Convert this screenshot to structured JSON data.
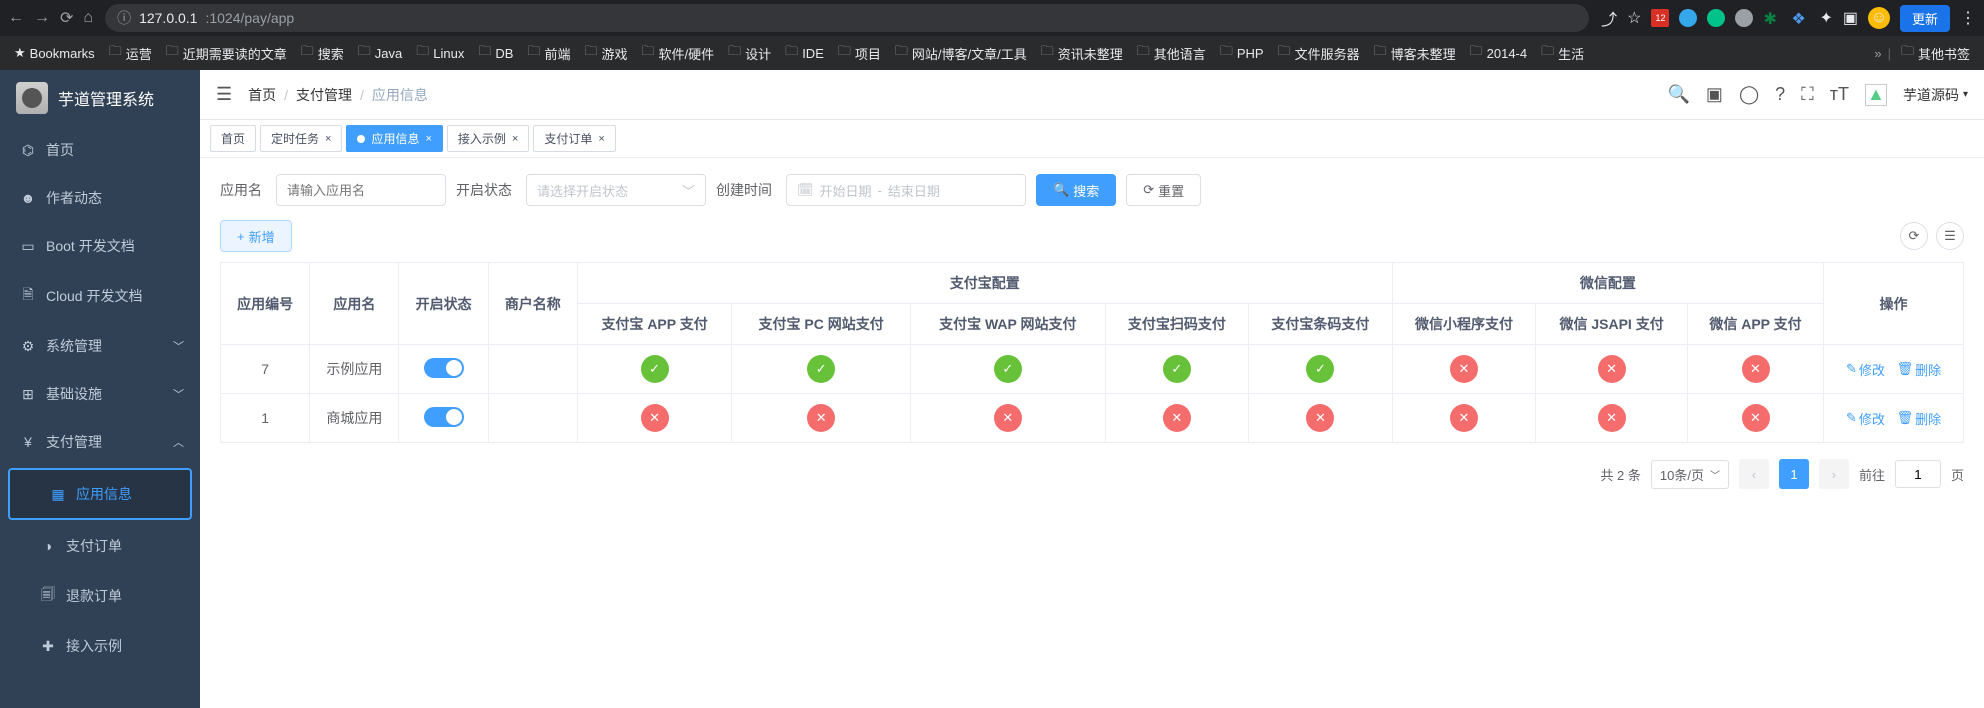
{
  "browser": {
    "url_host": "127.0.0.1",
    "url_port_path": ":1024/pay/app",
    "update": "更新",
    "bookmarks_label": "Bookmarks",
    "bookmarks": [
      "运营",
      "近期需要读的文章",
      "搜索",
      "Java",
      "Linux",
      "DB",
      "前端",
      "游戏",
      "软件/硬件",
      "设计",
      "IDE",
      "项目",
      "网站/博客/文章/工具",
      "资讯未整理",
      "其他语言",
      "PHP",
      "文件服务器",
      "博客未整理",
      "2014-4",
      "生活"
    ],
    "other_bookmarks": "其他书签",
    "ext_badge": "12"
  },
  "app": {
    "title": "芋道管理系统",
    "menu": {
      "home": "首页",
      "author": "作者动态",
      "boot": "Boot 开发文档",
      "cloud": "Cloud 开发文档",
      "sys": "系统管理",
      "infra": "基础设施",
      "pay": "支付管理",
      "pay_app": "应用信息",
      "pay_order": "支付订单",
      "pay_refund": "退款订单",
      "pay_demo": "接入示例"
    },
    "breadcrumb": {
      "home": "首页",
      "pay": "支付管理",
      "current": "应用信息"
    },
    "topbar_right_text": "芋道源码",
    "tabs": [
      {
        "label": "首页",
        "closable": false,
        "active": false
      },
      {
        "label": "定时任务",
        "closable": true,
        "active": false
      },
      {
        "label": "应用信息",
        "closable": true,
        "active": true
      },
      {
        "label": "接入示例",
        "closable": true,
        "active": false
      },
      {
        "label": "支付订单",
        "closable": true,
        "active": false
      }
    ]
  },
  "search": {
    "app_name_label": "应用名",
    "app_name_placeholder": "请输入应用名",
    "status_label": "开启状态",
    "status_placeholder": "请选择开启状态",
    "create_time_label": "创建时间",
    "start_placeholder": "开始日期",
    "end_placeholder": "结束日期",
    "range_sep": "-",
    "search_btn": "搜索",
    "reset_btn": "重置",
    "add_btn": "新增"
  },
  "table": {
    "columns": {
      "id": "应用编号",
      "name": "应用名",
      "status": "开启状态",
      "merchant": "商户名称",
      "alipay_group": "支付宝配置",
      "wechat_group": "微信配置",
      "alipay_app": "支付宝 APP 支付",
      "alipay_pc": "支付宝 PC 网站支付",
      "alipay_wap": "支付宝 WAP 网站支付",
      "alipay_qr": "支付宝扫码支付",
      "alipay_bar": "支付宝条码支付",
      "wx_mini": "微信小程序支付",
      "wx_jsapi": "微信 JSAPI 支付",
      "wx_app": "微信 APP 支付",
      "ops": "操作"
    },
    "rows": [
      {
        "id": "7",
        "name": "示例应用",
        "status_on": true,
        "merchant": "",
        "alipay_app": true,
        "alipay_pc": true,
        "alipay_wap": true,
        "alipay_qr": true,
        "alipay_bar": true,
        "wx_mini": false,
        "wx_jsapi": false,
        "wx_app": false
      },
      {
        "id": "1",
        "name": "商城应用",
        "status_on": true,
        "merchant": "",
        "alipay_app": false,
        "alipay_pc": false,
        "alipay_wap": false,
        "alipay_qr": false,
        "alipay_bar": false,
        "wx_mini": false,
        "wx_jsapi": false,
        "wx_app": false
      }
    ],
    "ops": {
      "edit": "修改",
      "delete": "删除"
    }
  },
  "pager": {
    "total_prefix": "共",
    "total_count": "2",
    "total_suffix": "条",
    "page_size": "10条/页",
    "current": "1",
    "goto_prefix": "前往",
    "goto_value": "1",
    "goto_suffix": "页"
  }
}
